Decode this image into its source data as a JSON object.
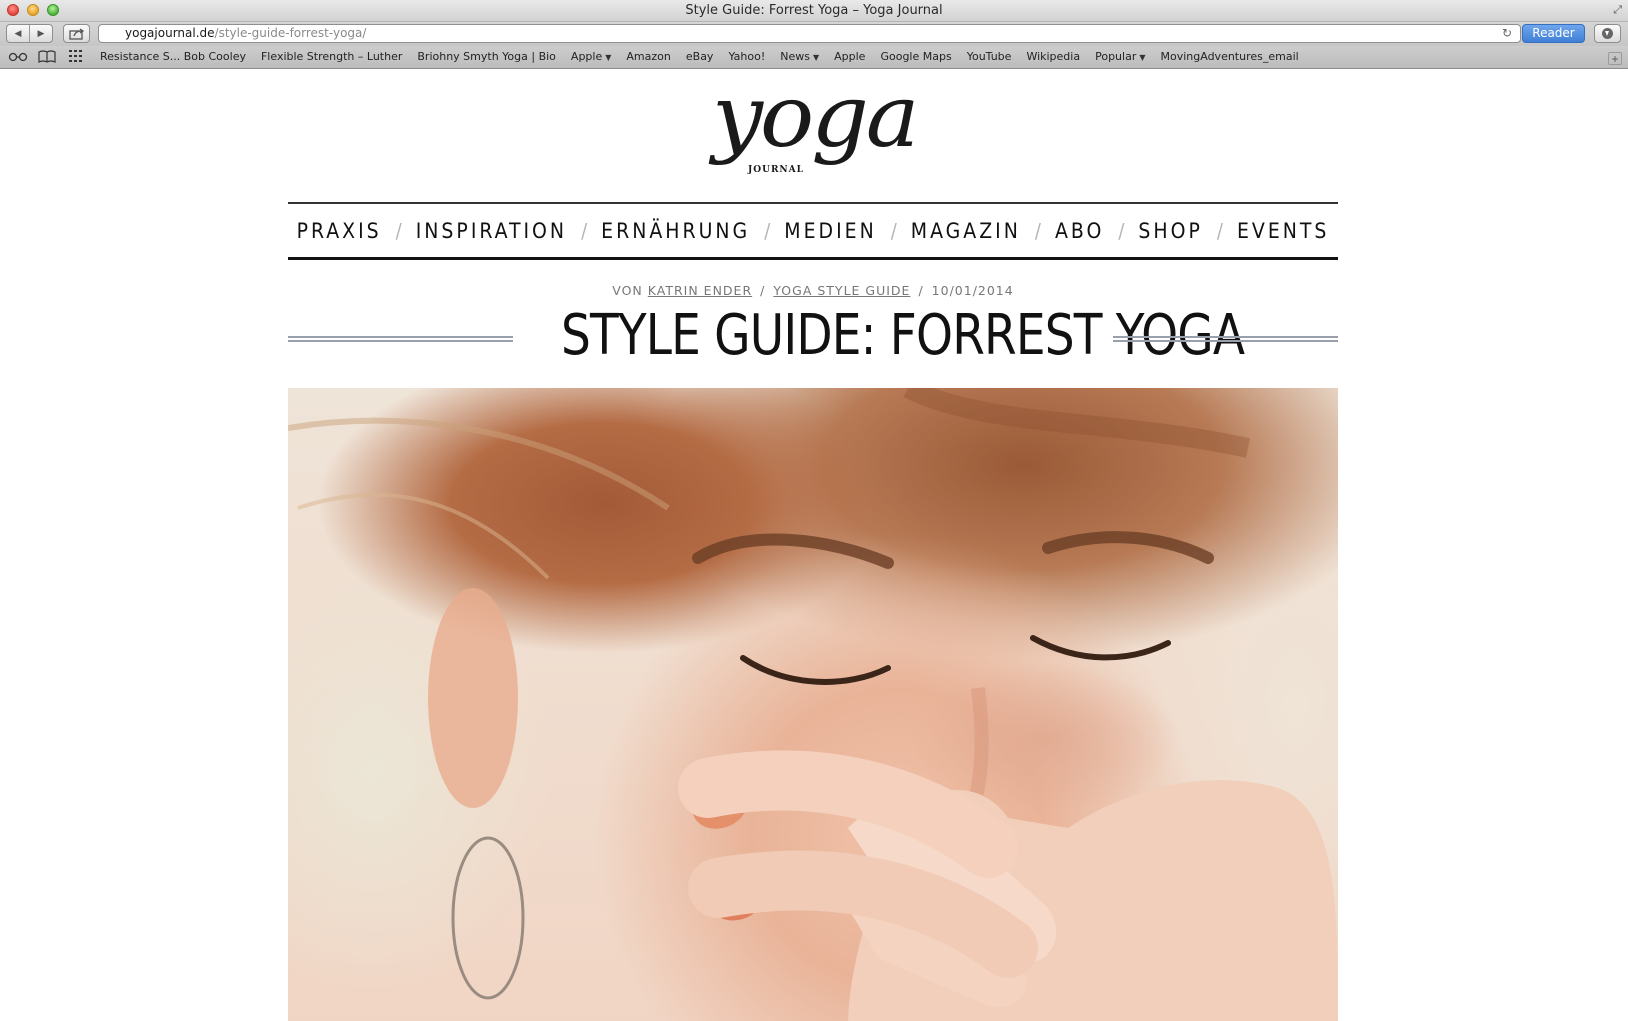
{
  "window": {
    "title": "Style Guide: Forrest Yoga – Yoga Journal"
  },
  "toolbar": {
    "url_domain": "yogajournal.de",
    "url_path": "/style-guide-forrest-yoga/",
    "reader_label": "Reader"
  },
  "bookmarks": [
    {
      "label": "Resistance S... Bob Cooley",
      "menu": false
    },
    {
      "label": "Flexible Strength – Luther",
      "menu": false
    },
    {
      "label": "Briohny Smyth Yoga | Bio",
      "menu": false
    },
    {
      "label": "Apple",
      "menu": true
    },
    {
      "label": "Amazon",
      "menu": false
    },
    {
      "label": "eBay",
      "menu": false
    },
    {
      "label": "Yahoo!",
      "menu": false
    },
    {
      "label": "News",
      "menu": true
    },
    {
      "label": "Apple",
      "menu": false
    },
    {
      "label": "Google Maps",
      "menu": false
    },
    {
      "label": "YouTube",
      "menu": false
    },
    {
      "label": "Wikipedia",
      "menu": false
    },
    {
      "label": "Popular",
      "menu": true
    },
    {
      "label": "MovingAdventures_email",
      "menu": false
    }
  ],
  "site": {
    "logo_word": "yoga",
    "logo_sub": "JOURNAL"
  },
  "nav": [
    "PRAXIS",
    "INSPIRATION",
    "ERNÄHRUNG",
    "MEDIEN",
    "MAGAZIN",
    "ABO",
    "SHOP",
    "EVENTS"
  ],
  "article": {
    "by_prefix": "VON",
    "author": "KATRIN ENDER",
    "category": "YOGA STYLE GUIDE",
    "date": "10/01/2014",
    "title": "STYLE GUIDE: FORREST YOGA"
  },
  "colors": {
    "reader_blue": "#4a88dc",
    "rule_gray": "#9a9fac",
    "text_dark": "#111111"
  },
  "icons": [
    "back-arrow-icon",
    "forward-arrow-icon",
    "share-icon",
    "reload-icon",
    "download-icon",
    "reading-list-icon",
    "bookmarks-book-icon",
    "top-sites-grid-icon",
    "add-bookmark-icon"
  ]
}
